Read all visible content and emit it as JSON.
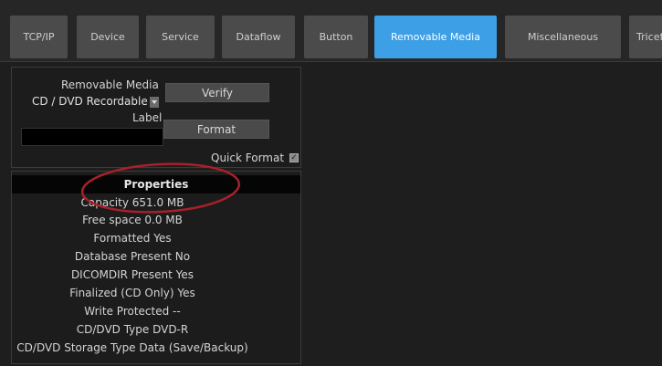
{
  "tabs": [
    {
      "label": "TCP/IP"
    },
    {
      "label": "Device"
    },
    {
      "label": "Service"
    },
    {
      "label": "Dataflow"
    },
    {
      "label": "Button"
    },
    {
      "label": "Removable Media"
    },
    {
      "label": "Miscellaneous"
    },
    {
      "label": "Tricefy"
    }
  ],
  "active_tab": "Removable Media",
  "media": {
    "removable_media_label": "Removable Media",
    "media_select_value": "CD / DVD Recordable",
    "verify_button": "Verify",
    "label_label": "Label",
    "label_value": "",
    "format_button": "Format",
    "quick_format_label": "Quick Format",
    "quick_format_checked": true
  },
  "properties": {
    "header": "Properties",
    "rows": [
      "Capacity 651.0 MB",
      "Free space 0.0 MB",
      "Formatted Yes",
      "Database Present No",
      "DICOMDIR Present Yes",
      "Finalized (CD Only) Yes",
      "Write Protected --",
      "CD/DVD Type DVD-R",
      "CD/DVD Storage Type Data (Save/Backup)"
    ]
  },
  "colors": {
    "active_tab": "#3d9fe6",
    "tab": "#4b4b4b",
    "background": "#1e1e1e",
    "annotation_ellipse": "#a8202a"
  }
}
